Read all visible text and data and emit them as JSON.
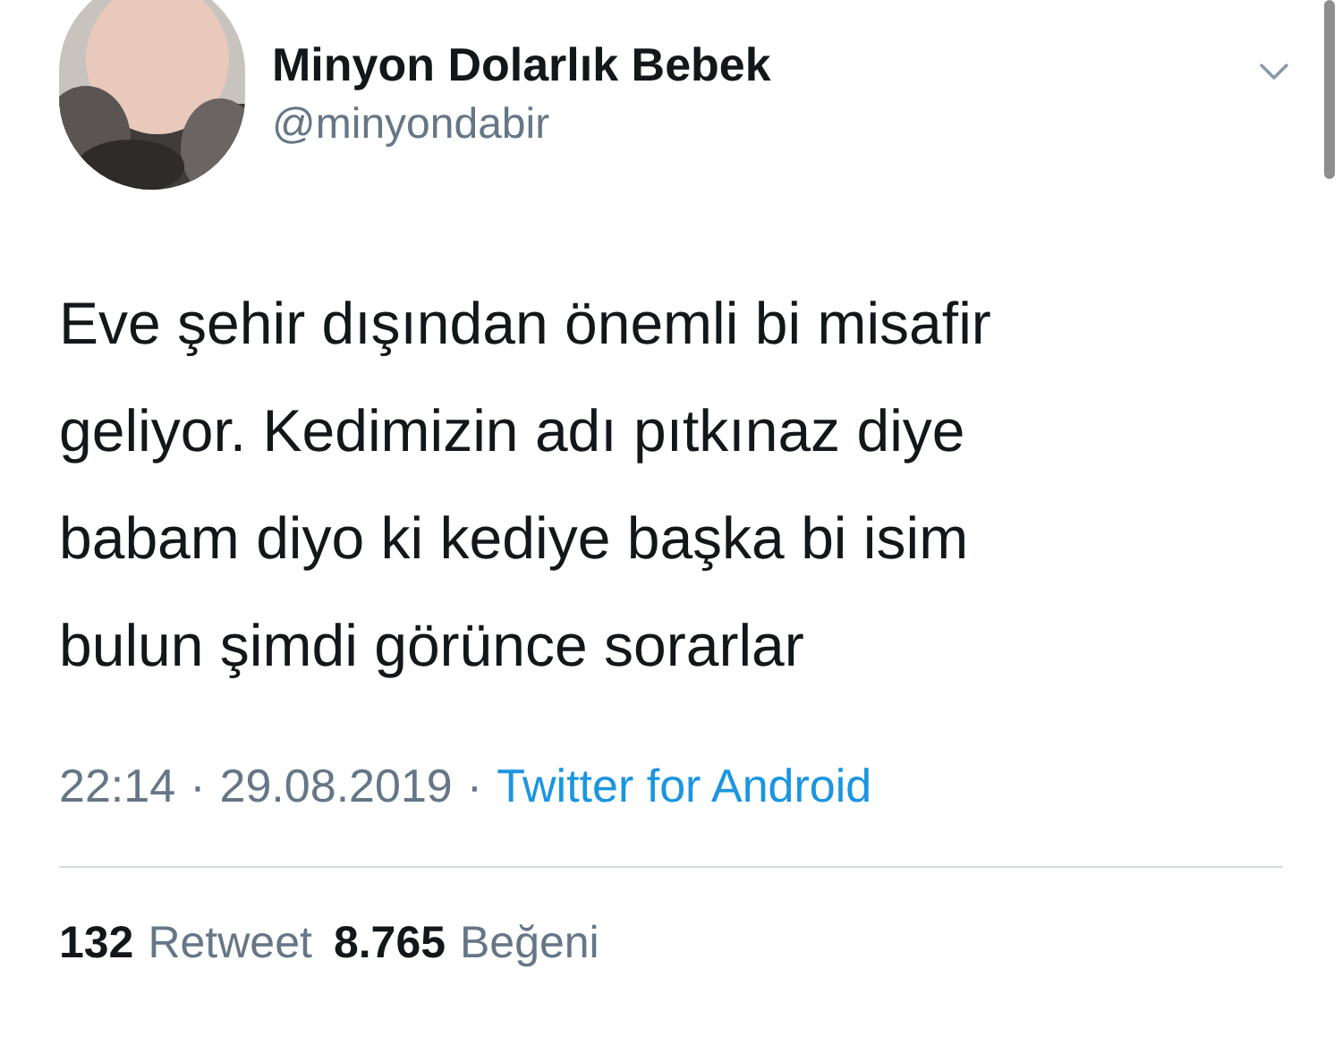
{
  "tweet": {
    "author": {
      "name": "Minyon Dolarlık Bebek",
      "handle": "@minyondabir"
    },
    "text": "Eve şehir dışından önemli bi misafir geliyor. Kedimizin adı pıtkınaz diye babam diyo ki kediye başka bi isim bulun şimdi görünce sorarlar",
    "time": "22:14",
    "separator_1": "·",
    "date": "29.08.2019",
    "separator_2": "·",
    "source": "Twitter for Android",
    "stats": [
      {
        "count": "132",
        "label": "Retweet"
      },
      {
        "count": "8.765",
        "label": "Beğeni"
      }
    ]
  }
}
